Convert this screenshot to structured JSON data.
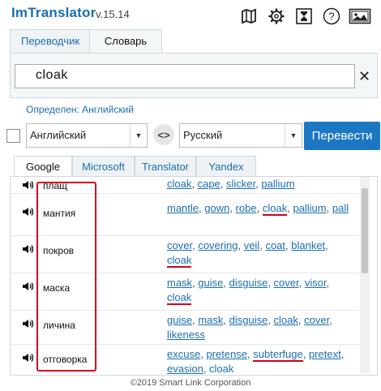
{
  "app": {
    "title": "ImTranslator",
    "version": "v.15.14"
  },
  "toolbar_icons": [
    "map-icon",
    "settings-gear-icon",
    "history-icon",
    "help-icon",
    "options-image-icon"
  ],
  "main_tabs": [
    {
      "label": "Переводчик",
      "active": false
    },
    {
      "label": "Словарь",
      "active": true
    }
  ],
  "input": {
    "value": "cloak",
    "clear_symbol": "✕"
  },
  "detected_language": "Определен: Английский",
  "source_language": "Английский",
  "target_language": "Русский",
  "swap_symbol": "<>",
  "translate_button": "Перевести",
  "provider_tabs": [
    {
      "label": "Google",
      "active": true
    },
    {
      "label": "Microsoft",
      "active": false
    },
    {
      "label": "Translator",
      "active": false
    },
    {
      "label": "Yandex",
      "active": false
    }
  ],
  "dictionary_rows": [
    {
      "word": "плащ",
      "translations": [
        "cloak",
        "cape",
        "slicker",
        "pallium"
      ],
      "highlighted": []
    },
    {
      "word": "мантия",
      "translations": [
        "mantle",
        "gown",
        "robe",
        "cloak",
        "pallium",
        "pall"
      ],
      "highlighted": [
        "cloak"
      ]
    },
    {
      "word": "покров",
      "translations": [
        "cover",
        "covering",
        "veil",
        "coat",
        "blanket",
        "cloak"
      ],
      "highlighted": [
        "cloak"
      ]
    },
    {
      "word": "маска",
      "translations": [
        "mask",
        "guise",
        "disguise",
        "cover",
        "visor",
        "cloak"
      ],
      "highlighted": [
        "cloak"
      ]
    },
    {
      "word": "личина",
      "translations": [
        "guise",
        "mask",
        "disguise",
        "cloak",
        "cover",
        "likeness"
      ],
      "highlighted": []
    },
    {
      "word": "отговорка",
      "translations": [
        "excuse",
        "pretense",
        "subterfuge",
        "pretext",
        "evasion",
        "cloak"
      ],
      "highlighted": [
        "subterfuge",
        "cloak"
      ]
    }
  ],
  "footer": "©2019 Smart Link Corporation",
  "colors": {
    "accent": "#1c77c3",
    "link": "#1a6fb0",
    "highlight": "#d4001a"
  }
}
